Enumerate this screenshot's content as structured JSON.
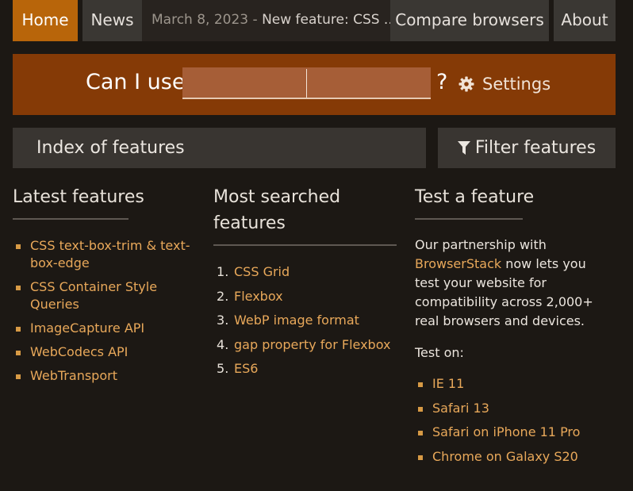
{
  "nav": {
    "home": "Home",
    "news": "News",
    "latest_date": "March 8, 2023",
    "latest_sep": " - ",
    "latest_title": "New feature: CSS ...",
    "compare": "Compare browsers",
    "about": "About"
  },
  "banner": {
    "label": "Can I use",
    "search_value": "",
    "question_mark": "?",
    "settings_label": "Settings"
  },
  "bars": {
    "index_label": "Index of features",
    "filter_label": "Filter features"
  },
  "latest": {
    "heading": "Latest features",
    "items": [
      "CSS text-box-trim & text-box-edge",
      "CSS Container Style Queries",
      "ImageCapture API",
      "WebCodecs API",
      "WebTransport"
    ]
  },
  "most_searched": {
    "heading": "Most searched features",
    "items": [
      "CSS Grid",
      "Flexbox",
      "WebP image format",
      "gap property for Flexbox",
      "ES6"
    ]
  },
  "test": {
    "heading": "Test a feature",
    "text_before": "Our partnership with ",
    "link": "BrowserStack",
    "text_after": " now lets you test your website for compatibility across 2,000+ real browsers and devices.",
    "test_on_label": "Test on:",
    "items": [
      "IE 11",
      "Safari 13",
      "Safari on iPhone 11 Pro",
      "Chrome on Galaxy S20"
    ]
  },
  "colors": {
    "accent": "#b8650a",
    "banner": "#853a06",
    "link": "#e8a85a",
    "background": "#1c1814"
  }
}
